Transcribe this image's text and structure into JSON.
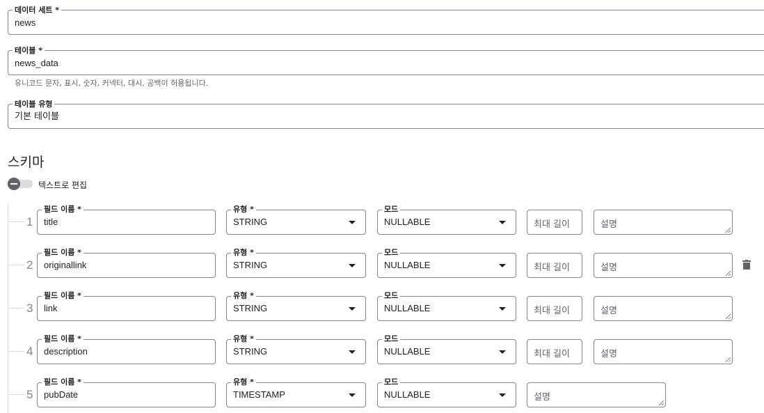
{
  "dataset": {
    "label": "데이터 세트 *",
    "value": "news"
  },
  "table": {
    "label": "테이블 *",
    "value": "news_data",
    "hint": "유니코드 문자, 표시, 숫자, 커넥터, 대시, 공백이 허용됩니다."
  },
  "table_type": {
    "label": "테이블 유형",
    "value": "기본 테이블"
  },
  "schema": {
    "title": "스키마",
    "edit_as_text_label": "텍스트로 편집",
    "edit_as_text_enabled": false,
    "field_name_label": "필드 이름 *",
    "type_label": "유형 *",
    "mode_label": "모드",
    "max_length_placeholder": "최대 길이",
    "description_placeholder": "설명",
    "fields": [
      {
        "index": "1",
        "name": "title",
        "type": "STRING",
        "mode": "NULLABLE"
      },
      {
        "index": "2",
        "name": "originallink",
        "type": "STRING",
        "mode": "NULLABLE"
      },
      {
        "index": "3",
        "name": "link",
        "type": "STRING",
        "mode": "NULLABLE"
      },
      {
        "index": "4",
        "name": "description",
        "type": "STRING",
        "mode": "NULLABLE"
      },
      {
        "index": "5",
        "name": "pubDate",
        "type": "TIMESTAMP",
        "mode": "NULLABLE"
      }
    ]
  },
  "icons": {
    "toggle": "toggle-switch-off",
    "delete": "trash-icon",
    "dropdown": "caret-down-icon"
  }
}
